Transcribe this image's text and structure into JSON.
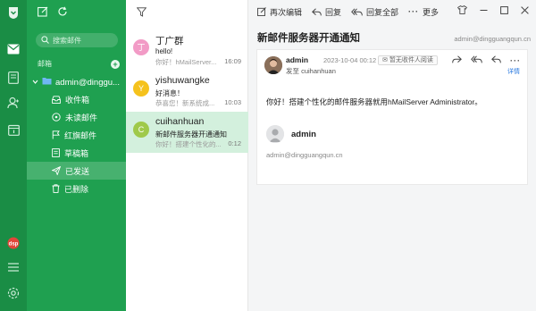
{
  "rail": {
    "icons": [
      "app-logo-icon",
      "mail-icon",
      "contacts-book-icon",
      "contact-icon",
      "calendar-icon",
      "promo-icon",
      "menu-icon",
      "settings-icon"
    ]
  },
  "folders": {
    "search_placeholder": "搜索邮件",
    "mailbox_section": "邮箱",
    "account": "admin@dinggu...",
    "items": [
      {
        "label": "收件箱",
        "icon": "inbox-icon"
      },
      {
        "label": "未读邮件",
        "icon": "unread-icon"
      },
      {
        "label": "红旗邮件",
        "icon": "flag-icon"
      },
      {
        "label": "草稿箱",
        "icon": "draft-icon"
      },
      {
        "label": "已发送",
        "icon": "send-icon"
      },
      {
        "label": "已删除",
        "icon": "trash-icon"
      }
    ],
    "active_index": 4
  },
  "messages": [
    {
      "initial": "丁",
      "name": "丁广群",
      "subject": "hello!",
      "preview": "你好！hMailServer...",
      "time": "16:09",
      "avatar_color": "#f29bc6"
    },
    {
      "initial": "Y",
      "name": "yishuwangke",
      "subject": "好消息！",
      "preview": "恭喜您！新系统成...",
      "time": "10:03",
      "avatar_color": "#f5c21d"
    },
    {
      "initial": "C",
      "name": "cuihanhuan",
      "subject": "新邮件服务器开通通知",
      "preview": "你好！搭建个性化的...",
      "time": "0:12",
      "avatar_color": "#9fc94a"
    }
  ],
  "selected_message": 2,
  "toolbar": {
    "edit_again": "再次编辑",
    "reply": "回复",
    "reply_all": "回复全部",
    "more": "更多"
  },
  "email": {
    "subject": "新邮件服务器开通通知",
    "account": "admin@dingguangqun.cn",
    "sender": "admin",
    "date": "2023-10-04 00:12",
    "read_status": "暂无收件人阅读",
    "to_label": "发至",
    "to": "cuihanhuan",
    "details": "详情",
    "body": "你好！搭建个性化的邮件服务器就用hMailServer Administrator。",
    "signature_name": "admin",
    "signature_email": "admin@dingguangqun.cn"
  },
  "colors": {
    "rail": "#1a8d45",
    "sidebar": "#1fa050",
    "selected_row": "#d3f0dd",
    "link": "#2b7be0"
  }
}
